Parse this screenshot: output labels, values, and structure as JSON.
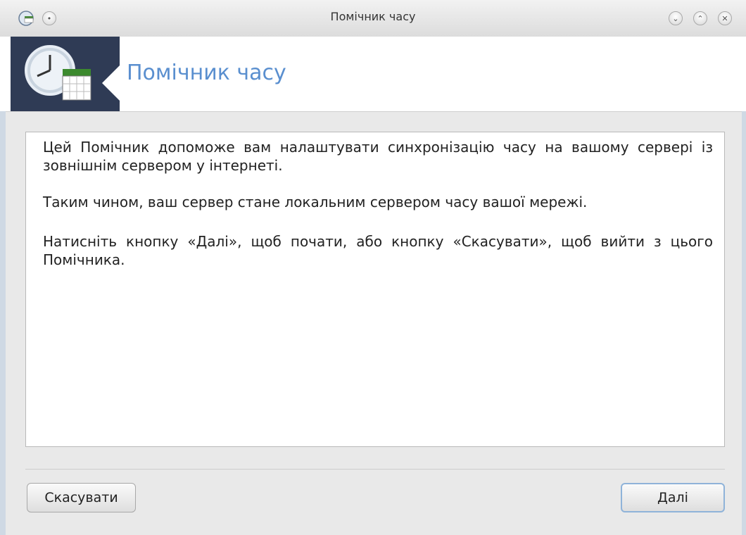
{
  "window": {
    "title": "Помічник часу",
    "accent_color": "#5a8fcf",
    "controls": [
      "minimize-icon",
      "maximize-icon",
      "close-icon"
    ]
  },
  "header": {
    "title": "Помічник часу",
    "icon": "clock-calendar-icon"
  },
  "content": {
    "paragraph1": "Цей Помічник допоможе вам налаштувати синхронізацію часу на вашому сервері із зовнішнім сервером у інтернеті.",
    "paragraph2": "Таким чином, ваш сервер стане локальним сервером часу вашої мережі.",
    "paragraph3": "Натисніть кнопку «Далі», щоб почати, або кнопку «Скасувати», щоб вийти з цього Помічника."
  },
  "buttons": {
    "cancel_label": "Скасувати",
    "next_label": "Далі"
  }
}
